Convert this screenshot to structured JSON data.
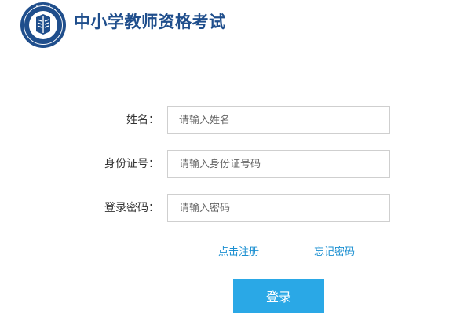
{
  "header": {
    "title": "中小学教师资格考试",
    "logo_icon": "teacher-qualification-emblem-icon"
  },
  "form": {
    "name": {
      "label": "姓名：",
      "placeholder": "请输入姓名",
      "value": ""
    },
    "id_number": {
      "label": "身份证号：",
      "placeholder": "请输入身份证号码",
      "value": ""
    },
    "password": {
      "label": "登录密码：",
      "placeholder": "请输入密码",
      "value": ""
    }
  },
  "links": {
    "register": "点击注册",
    "forgot_password": "忘记密码"
  },
  "actions": {
    "login_label": "登录"
  },
  "colors": {
    "brand": "#1f4e8c",
    "link": "#1a8fd1",
    "button": "#2aa8e6"
  }
}
